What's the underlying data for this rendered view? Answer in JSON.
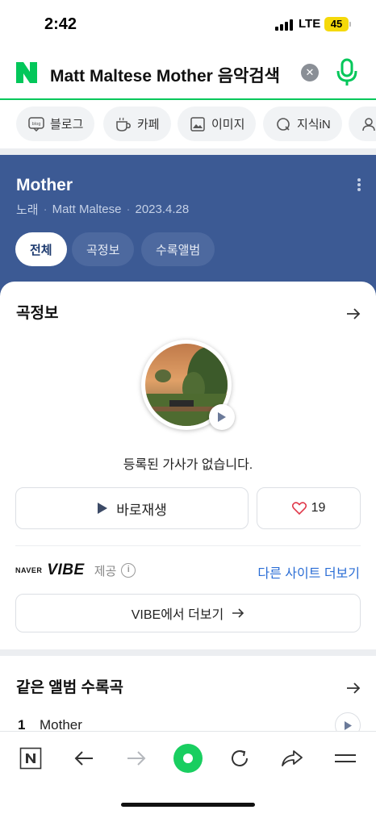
{
  "status_bar": {
    "time": "2:42",
    "network": "LTE",
    "battery": "45"
  },
  "search": {
    "query": "Matt Maltese Mother 음악검색"
  },
  "tabs": [
    {
      "label": "블로그",
      "icon": "blog-icon"
    },
    {
      "label": "카페",
      "icon": "cafe-cup-icon"
    },
    {
      "label": "이미지",
      "icon": "image-icon"
    },
    {
      "label": "지식iN",
      "icon": "qna-icon"
    }
  ],
  "song": {
    "title": "Mother",
    "type": "노래",
    "artist": "Matt Maltese",
    "date": "2023.4.28"
  },
  "filters": [
    {
      "label": "전체",
      "active": true
    },
    {
      "label": "곡정보",
      "active": false
    },
    {
      "label": "수록앨범",
      "active": false
    }
  ],
  "song_info": {
    "title": "곡정보",
    "no_lyrics": "등록된 가사가 없습니다.",
    "play_label": "바로재생",
    "likes": "19",
    "provider_naver": "NAVER",
    "provider_vibe": "VIBE",
    "provider_suffix": "제공",
    "other_sites": "다른 사이트 더보기",
    "more_vibe": "VIBE에서 더보기"
  },
  "same_album": {
    "title": "같은 앨범 수록곡",
    "tracks": [
      {
        "num": "1",
        "name": "Mother"
      }
    ]
  },
  "colors": {
    "accent": "#03c75a",
    "header_bg": "#3c5a94",
    "link": "#2a6dd5"
  }
}
